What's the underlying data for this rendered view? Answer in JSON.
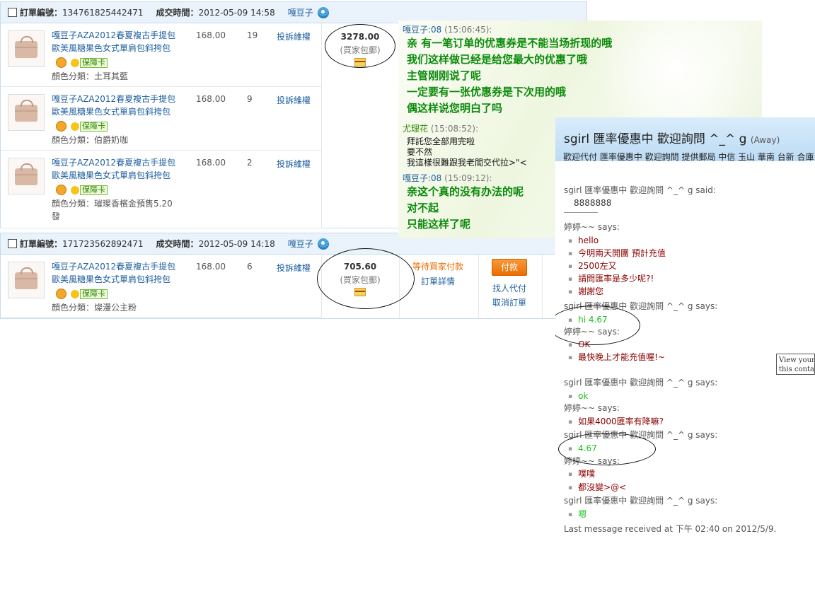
{
  "orders": [
    {
      "order_label": "訂單編號：",
      "order_no": "134761825442471",
      "time_label": "成交時間：",
      "time": "2012-05-09 14:58",
      "seller": "嘎豆子",
      "total": "3278.00",
      "shipping_note": "(買家包郵)",
      "items": [
        {
          "title": "嘎豆子AZA2012春夏複古手提包歐美風糖果色女式單肩包斜挎包",
          "color": "顏色分類：土耳其藍",
          "price": "168.00",
          "qty": "19",
          "complain": "投訴維權",
          "badge": "保障卡"
        },
        {
          "title": "嘎豆子AZA2012春夏複古手提包歐美風糖果色女式單肩包斜挎包",
          "color": "顏色分類：伯爵奶咖",
          "price": "168.00",
          "qty": "9",
          "complain": "投訴維權",
          "badge": "保障卡"
        },
        {
          "title": "嘎豆子AZA2012春夏複古手提包歐美風糖果色女式單肩包斜挎包",
          "color": "顏色分類：璀璨香檳金預售5.20發",
          "price": "168.00",
          "qty": "2",
          "complain": "投訴維權",
          "badge": "保障卡"
        }
      ]
    },
    {
      "order_label": "訂單編號：",
      "order_no": "171723562892471",
      "time_label": "成交時間：",
      "time": "2012-05-09 14:18",
      "seller": "嘎豆子",
      "total": "705.60",
      "shipping_note": "(買家包郵)",
      "status": "等待買家付款",
      "status_detail": "訂單詳情",
      "pay_label": "付款",
      "find_pay_label": "找人代付",
      "cancel_label": "取消訂單",
      "items": [
        {
          "title": "嘎豆子AZA2012春夏複古手提包歐美風糖果色女式單肩包斜挎包",
          "color": "顏色分類：燦漫公主粉",
          "price": "168.00",
          "qty": "6",
          "complain": "投訴維權",
          "badge": "保障卡"
        }
      ]
    }
  ],
  "qq_chat": {
    "messages": [
      {
        "name": "嘎豆子:08",
        "time": "(15:06:45):",
        "lines": [
          "亲 有一笔订单的优惠券是不能当场折现的哦",
          "我们这样做已经是给您最大的优惠了哦",
          "主管刚刚说了呢",
          "一定要有一张优惠券是下次用的哦",
          "偶这样说您明白了吗"
        ]
      },
      {
        "name": "尤理花",
        "time": "(15:08:52):",
        "lines": [
          "拜託您全部用完啦",
          "要不然",
          "我這樣很難跟我老闆交代拉>\"<"
        ]
      },
      {
        "name": "嘎豆子:08",
        "time": "(15:09:12):",
        "lines": [
          "亲这个真的没有办法的呢",
          "对不起",
          "只能这样了呢"
        ]
      }
    ]
  },
  "msn": {
    "title": "sgirl   匯率優惠中 歡迎詢問 ^_^  g",
    "status": "(Away)",
    "subtitle": "歡迎代付 匯率優惠中 歡迎詢問  提供郵局 中信 玉山 華南 台新 合庫",
    "log": {
      "s1": "sgirl   匯率優惠中 歡迎詢問 ^_^  g said:",
      "s1_line": "8888888",
      "t1": "婷婷~~ says:",
      "t1_lines": [
        "hello",
        "今明兩天開團 預計充值",
        "2500左又",
        "請問匯率是多少呢?!",
        "謝謝您"
      ],
      "s2": "sgirl   匯率優惠中 歡迎詢問 ^_^  g says:",
      "s2_lines": [
        "hi 4.67"
      ],
      "t2": "婷婷~~ says:",
      "t2_lines": [
        "OK",
        "最快晚上才能充值喔!~"
      ],
      "s3": "sgirl   匯率優惠中 歡迎詢問 ^_^  g says:",
      "s3_lines": [
        "ok"
      ],
      "t3": "婷婷~~ says:",
      "t3_lines": [
        "如果4000匯率有降嘛?"
      ],
      "s4": "sgirl   匯率優惠中 歡迎詢問 ^_^  g says:",
      "s4_lines": [
        "4.67"
      ],
      "t4": "婷婷~~ says:",
      "t4_lines": [
        "噗噗",
        "都沒變>@<"
      ],
      "s5": "sgirl   匯率優惠中 歡迎詢問 ^_^  g says:",
      "s5_lines": [
        "嗯"
      ]
    },
    "footer": "Last message received at 下午 02:40 on 2012/5/9."
  },
  "tooltip": {
    "line1": "View your",
    "line2": "this contact"
  }
}
